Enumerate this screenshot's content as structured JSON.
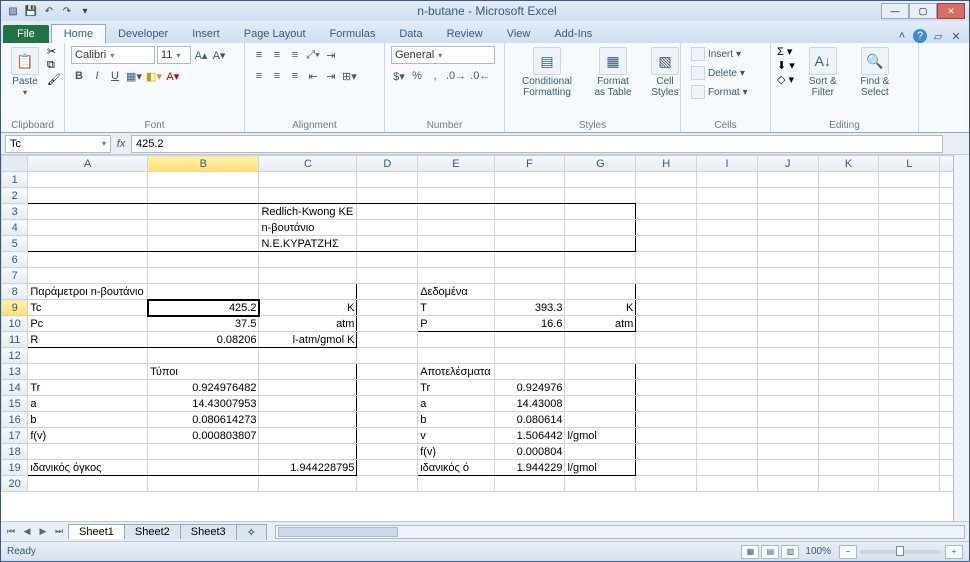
{
  "qat_tooltip": "Quick Access",
  "title": "n-butane  -  Microsoft Excel",
  "tabs": {
    "file": "File",
    "home": "Home",
    "developer": "Developer",
    "insert": "Insert",
    "pageLayout": "Page Layout",
    "formulas": "Formulas",
    "data": "Data",
    "review": "Review",
    "view": "View",
    "addins": "Add-Ins"
  },
  "ribbon": {
    "clipboard": {
      "label": "Clipboard",
      "paste": "Paste"
    },
    "font": {
      "label": "Font",
      "name": "Calibri",
      "size": "11",
      "bold": "B",
      "italic": "I",
      "underline": "U"
    },
    "alignment": {
      "label": "Alignment"
    },
    "number": {
      "label": "Number",
      "format": "General"
    },
    "styles": {
      "label": "Styles",
      "cond": "Conditional Formatting",
      "fmt": "Format as Table",
      "cell": "Cell Styles"
    },
    "cells": {
      "label": "Cells",
      "insert": "Insert",
      "delete": "Delete",
      "format": "Format"
    },
    "editing": {
      "label": "Editing",
      "sort": "Sort & Filter",
      "find": "Find & Select"
    }
  },
  "namebox": "Tc",
  "formula": "425.2",
  "columns": [
    "A",
    "B",
    "C",
    "D",
    "E",
    "F",
    "G",
    "H",
    "I",
    "J",
    "K",
    "L",
    "M"
  ],
  "cells": {
    "C3": "Redlich-Kwong  KE",
    "C4": "n-βουτάνιο",
    "C5": "Ν.Ε.ΚΥΡΑΤΖΗΣ",
    "A8": "Παράμετροι n-βουτάνιο",
    "E8": "Δεδομένα",
    "A9": "Tc",
    "B9": "425.2",
    "C9": "K",
    "E9": "T",
    "F9": "393.3",
    "G9": "K",
    "A10": "Pc",
    "B10": "37.5",
    "C10": "atm",
    "E10": "P",
    "F10": "16.6",
    "G10": "atm",
    "A11": "R",
    "B11": "0.08206",
    "C11": "l-atm/gmol K",
    "B13": "Τύποι",
    "E13": "Αποτελέσματα",
    "A14": "Tr",
    "B14": "0.924976482",
    "E14": "Tr",
    "F14": "0.924976",
    "A15": "a",
    "B15": "14.43007953",
    "E15": "a",
    "F15": "14.43008",
    "A16": "b",
    "B16": "0.080614273",
    "E16": "b",
    "F16": "0.080614",
    "A17": "f(v)",
    "B17": "0.000803807",
    "E17": "v",
    "F17": "1.506442",
    "G17": "l/gmol",
    "E18": "f(v)",
    "F18": "0.000804",
    "A19": "ιδανικός όγκος",
    "C19": "1.944228795",
    "E19": "ιδανικός ό",
    "F19": "1.944229",
    "G19": "l/gmol"
  },
  "sheets": {
    "s1": "Sheet1",
    "s2": "Sheet2",
    "s3": "Sheet3"
  },
  "status": {
    "ready": "Ready",
    "zoom": "100%"
  },
  "chart_data": {
    "type": "table",
    "title": "Redlich-Kwong KE — n-βουτάνιο",
    "author": "Ν.Ε.ΚΥΡΑΤΖΗΣ",
    "parameters": {
      "Tc": 425.2,
      "Tc_unit": "K",
      "Pc": 37.5,
      "Pc_unit": "atm",
      "R": 0.08206,
      "R_unit": "l-atm/gmol K"
    },
    "given": {
      "T": 393.3,
      "T_unit": "K",
      "P": 16.6,
      "P_unit": "atm"
    },
    "formulas": {
      "Tr": 0.924976482,
      "a": 14.43007953,
      "b": 0.080614273,
      "f_v": 0.000803807,
      "ideal_volume": 1.944228795
    },
    "results": {
      "Tr": 0.924976,
      "a": 14.43008,
      "b": 0.080614,
      "v": 1.506442,
      "v_unit": "l/gmol",
      "f_v": 0.000804,
      "ideal_volume": 1.944229,
      "ideal_volume_unit": "l/gmol"
    }
  }
}
